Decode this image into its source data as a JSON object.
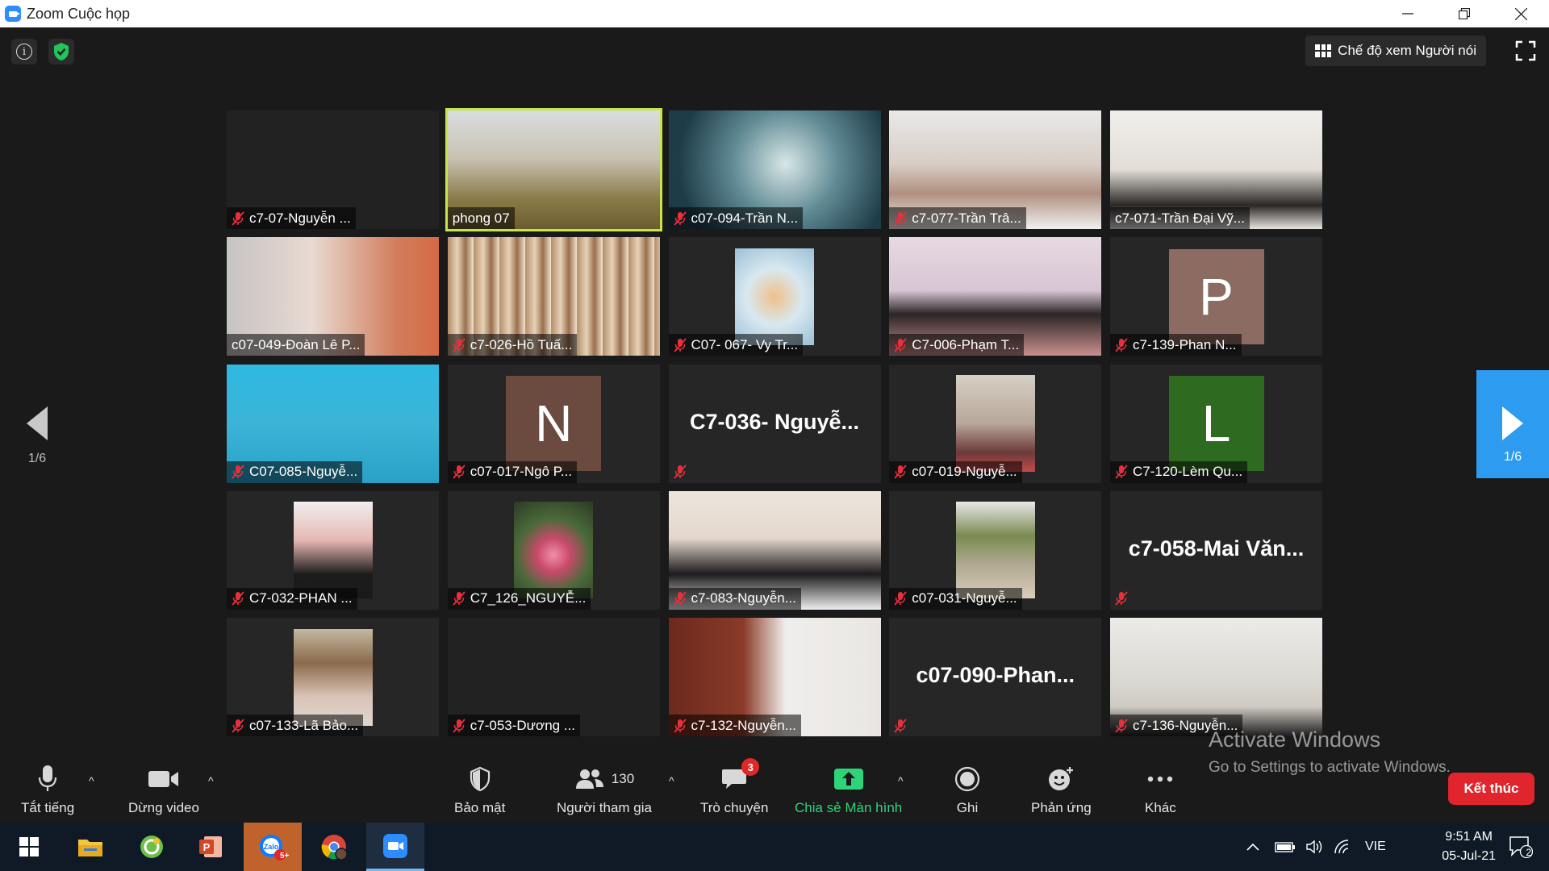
{
  "window": {
    "title": "Zoom Cuộc họp",
    "minimize_icon": "minimize-icon",
    "restore_icon": "restore-icon",
    "close_icon": "close-icon"
  },
  "top": {
    "view_label": "Chế độ xem Người nói"
  },
  "page_left": "1/6",
  "page_right": "1/6",
  "tiles": [
    {
      "name": "c7-07-Nguyễn ...",
      "muted": true,
      "video": "none",
      "bg": "#222222"
    },
    {
      "name": "phong 07",
      "muted": false,
      "video": "cam",
      "bg": "linear-gradient(180deg,#d9dde0 0%,#c9c2b2 40%,#8a7a48 75%,#6b5d30 100%)",
      "active": true
    },
    {
      "name": "c07-094-Trần N...",
      "muted": true,
      "video": "cam",
      "bg": "radial-gradient(circle at 55% 45%,#d8e6e6 0%,#5f8a94 40%,#1e3c48 80%)"
    },
    {
      "name": "c7-077-Trần Trâ...",
      "muted": true,
      "video": "cam",
      "bg": "linear-gradient(180deg,#e9e9e9 0%,#d8cdc5 45%,#b08f80 70%,#f0f0f0 100%)"
    },
    {
      "name": "c7-071-Trần Đại Vỹ...",
      "muted": false,
      "video": "cam",
      "bg": "linear-gradient(180deg,#f1efec 0%,#e2ddd6 50%,#2a2726 80%,#e8e4df 100%)"
    },
    {
      "name": "c07-049-Đoàn Lê P...",
      "muted": false,
      "video": "cam",
      "bg": "linear-gradient(90deg,#c6c3c2 0%,#e8dad2 40%,#d27d5c 80%,#d56a45 100%)"
    },
    {
      "name": "c7-026-Hồ Tuấ...",
      "muted": true,
      "video": "cam",
      "bg": "repeating-linear-gradient(90deg,#b58f69 0px,#e6d2b8 12px,#9a6f4c 22px,#f1e3cf 32px)"
    },
    {
      "name": "C07- 067- Vy Tr...",
      "muted": true,
      "video": "pic",
      "bg": "#262626",
      "pic": "radial-gradient(circle at 50% 50%,#f0c08a 0%,#d8e8f0 45%,#9bc0d6 100%)"
    },
    {
      "name": "C7-006-Phạm T...",
      "muted": true,
      "video": "cam",
      "bg": "linear-gradient(180deg,#e7d9e2 0%,#d7c5d3 45%,#2b2526 65%,#c98f8c 100%)"
    },
    {
      "name": "c7-139-Phan N...",
      "muted": true,
      "video": "avatar",
      "bg": "#262626",
      "letter": "P",
      "avatar_color": "#8c6b62"
    },
    {
      "name": "C07-085-Nguyễ...",
      "muted": true,
      "video": "cam",
      "bg": "linear-gradient(180deg,#2fb9e2 0%,#3bb4d8 50%,#2aa0c6 100%)"
    },
    {
      "name": "c07-017-Ngô P...",
      "muted": true,
      "video": "avatar",
      "bg": "#262626",
      "letter": "N",
      "avatar_color": "#6b4a40"
    },
    {
      "name": "",
      "muted": true,
      "video": "bigname",
      "bg": "#262626",
      "big": "C7-036-  Nguyễ..."
    },
    {
      "name": "c07-019-Nguyễ...",
      "muted": true,
      "video": "pic",
      "bg": "#262626",
      "pic": "linear-gradient(180deg,#d6d0c4 0%,#b8a79a 50%,#6b3a3a 80%,#c54a4a 100%)"
    },
    {
      "name": "C7-120-Lèm Qu...",
      "muted": true,
      "video": "avatar",
      "bg": "#262626",
      "letter": "L",
      "avatar_color": "#2e6b20"
    },
    {
      "name": "C7-032-PHAN ...",
      "muted": true,
      "video": "pic",
      "bg": "#262626",
      "pic": "linear-gradient(180deg,#efefef 0%,#e6b7b2 40%,#1c1c1c 75%,#1a1a1a 100%)"
    },
    {
      "name": "C7_126_NGUYỄ...",
      "muted": true,
      "video": "pic",
      "bg": "#262626",
      "pic": "radial-gradient(circle at 50% 55%,#f090a8 0%,#c84a6a 25%,#4a6a3a 55%,#2c3a24 100%)"
    },
    {
      "name": "c7-083-Nguyễn...",
      "muted": true,
      "video": "cam",
      "bg": "linear-gradient(180deg,#ece6dd 0%,#e3d7cc 40%,#1c1a1a 70%,#eeeeee 100%)"
    },
    {
      "name": "c07-031-Nguyễ...",
      "muted": true,
      "video": "pic",
      "bg": "#262626",
      "pic": "linear-gradient(180deg,#e8e8e8 0%,#7a8a50 35%,#b0a890 65%,#d8cdbb 100%)"
    },
    {
      "name": "",
      "muted": true,
      "video": "bigname",
      "bg": "#262626",
      "big": "c7-058-Mai  Văn..."
    },
    {
      "name": "c07-133-Lã Bảo...",
      "muted": true,
      "video": "pic",
      "bg": "#262626",
      "pic": "linear-gradient(180deg,#c2b8a0 0%,#8c6a4c 35%,#d9c4b8 70%,#e0d6d0 100%)"
    },
    {
      "name": "c7-053-Dương ...",
      "muted": true,
      "video": "none",
      "bg": "#222222"
    },
    {
      "name": "c7-132-Nguyễn...",
      "muted": true,
      "video": "cam",
      "bg": "linear-gradient(90deg,#6b2a1e 0%,#8a3a28 35%,#f0eeec 55%,#e9e6e2 100%)"
    },
    {
      "name": "",
      "muted": true,
      "video": "bigname",
      "bg": "#262626",
      "big": "c07-090-Phan..."
    },
    {
      "name": "c7-136-Nguyễn...",
      "muted": true,
      "video": "cam",
      "bg": "linear-gradient(180deg,#ecebe8 0%,#dcdad4 50%,#cfcac2 75%,#1c1c1c 100%)"
    }
  ],
  "controls": {
    "mute": "Tắt tiếng",
    "stop_video": "Dừng video",
    "security": "Bảo mật",
    "participants": "Người tham gia",
    "participants_count": "130",
    "chat": "Trò chuyện",
    "chat_badge": "3",
    "share": "Chia sẻ Màn hình",
    "record": "Ghi",
    "reactions": "Phản ứng",
    "more": "Khác",
    "end": "Kết thúc"
  },
  "watermark": {
    "line1": "Activate Windows",
    "line2": "Go to Settings to activate Windows."
  },
  "taskbar": {
    "zalo_badge": "5+",
    "language": "VIE",
    "time": "9:51 AM",
    "date": "05-Jul-21",
    "notifications": "2"
  },
  "colors": {
    "accent_blue": "#2d8cff",
    "share_green": "#2ed47a",
    "end_red": "#e0262c",
    "active_speaker": "#c5e64a"
  }
}
